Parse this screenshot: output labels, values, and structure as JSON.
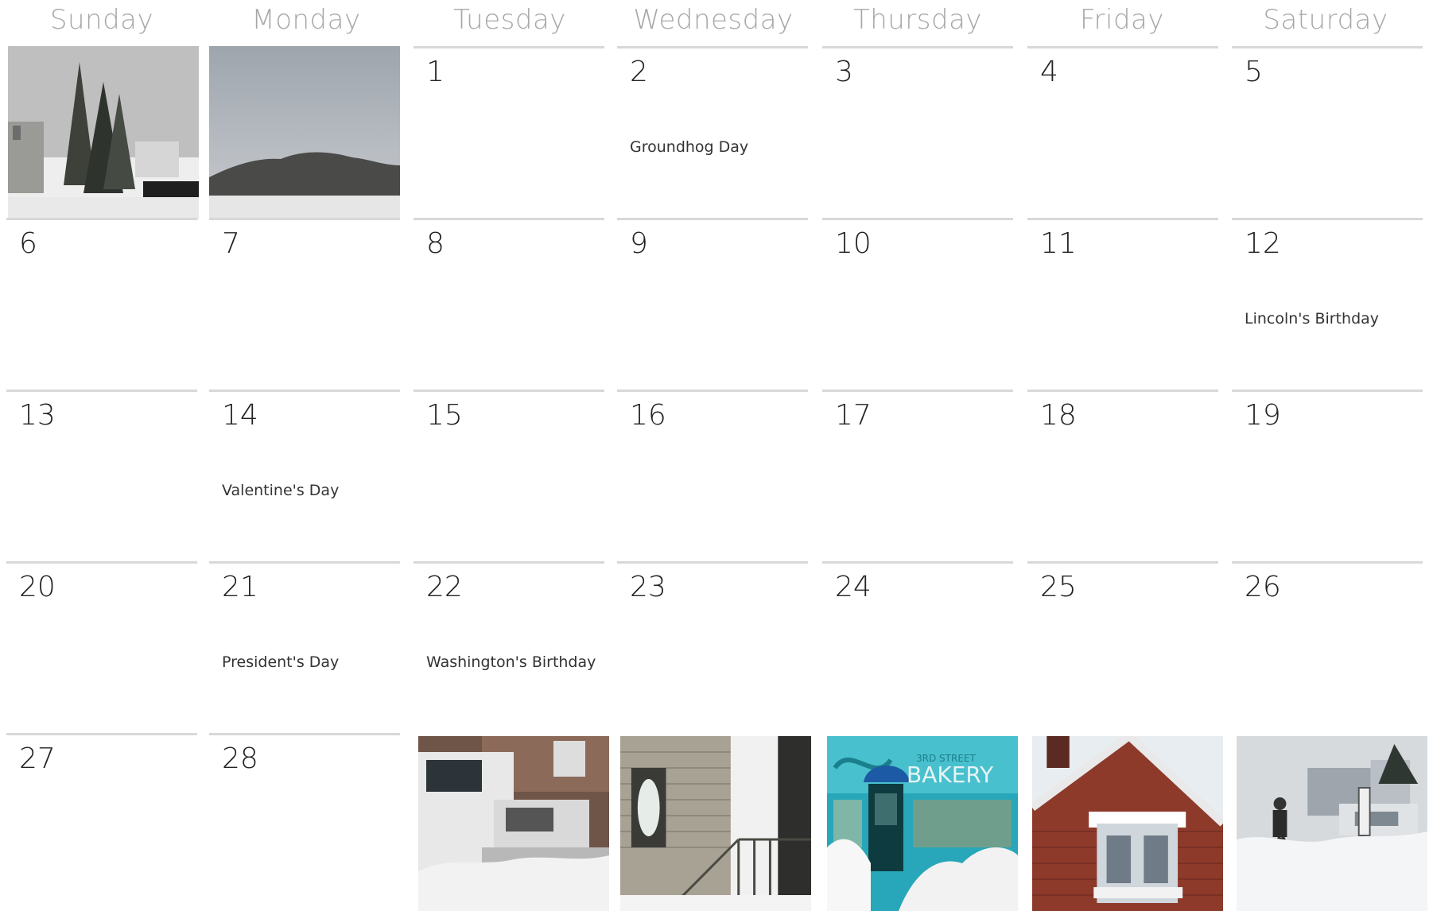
{
  "calendar": {
    "weekdays": [
      "Sunday",
      "Monday",
      "Tuesday",
      "Wednesday",
      "Thursday",
      "Friday",
      "Saturday"
    ],
    "days": {
      "d1": "1",
      "d2": "2",
      "d3": "3",
      "d4": "4",
      "d5": "5",
      "d6": "6",
      "d7": "7",
      "d8": "8",
      "d9": "9",
      "d10": "10",
      "d11": "11",
      "d12": "12",
      "d13": "13",
      "d14": "14",
      "d15": "15",
      "d16": "16",
      "d17": "17",
      "d18": "18",
      "d19": "19",
      "d20": "20",
      "d21": "21",
      "d22": "22",
      "d23": "23",
      "d24": "24",
      "d25": "25",
      "d26": "26",
      "d27": "27",
      "d28": "28"
    },
    "events": {
      "d2": "Groundhog Day",
      "d12": "Lincoln's Birthday",
      "d14": "Valentine's Day",
      "d21": "President's Day",
      "d22": "Washington's Birthday"
    },
    "photos": {
      "bakery_sign": "BAKERY",
      "bakery_subsign": "3RD STREET"
    }
  }
}
